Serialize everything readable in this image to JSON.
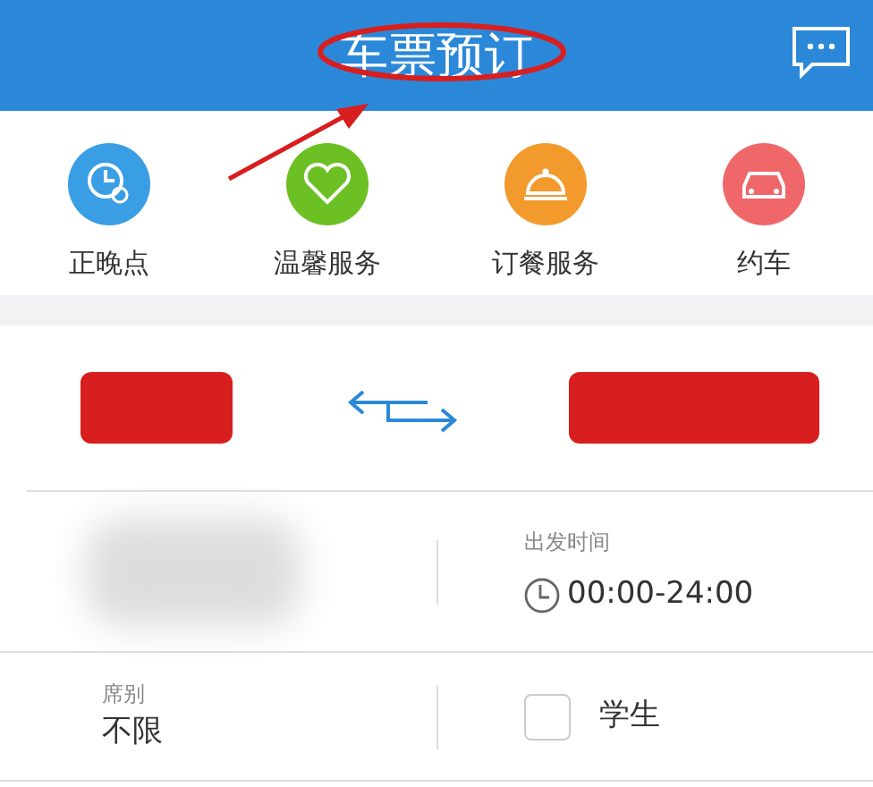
{
  "header": {
    "title": "车票预订"
  },
  "services": [
    {
      "label": "正晚点",
      "kind": "clock",
      "color": "#3a9ee4"
    },
    {
      "label": "温馨服务",
      "kind": "heart",
      "color": "#6cc024"
    },
    {
      "label": "订餐服务",
      "kind": "bell",
      "color": "#f39a2c"
    },
    {
      "label": "约车",
      "kind": "car",
      "color": "#f0676a"
    }
  ],
  "stations": [
    {
      "redacted": true
    },
    {
      "redacted": true
    }
  ],
  "date": {
    "blurred": true
  },
  "departure_time": {
    "label": "出发时间",
    "value": "00:00-24:00"
  },
  "seat": {
    "label": "席别",
    "value": "不限"
  },
  "student": {
    "label": "学生",
    "checked": false
  },
  "annotations": {
    "ellipse": true,
    "arrow": true
  }
}
